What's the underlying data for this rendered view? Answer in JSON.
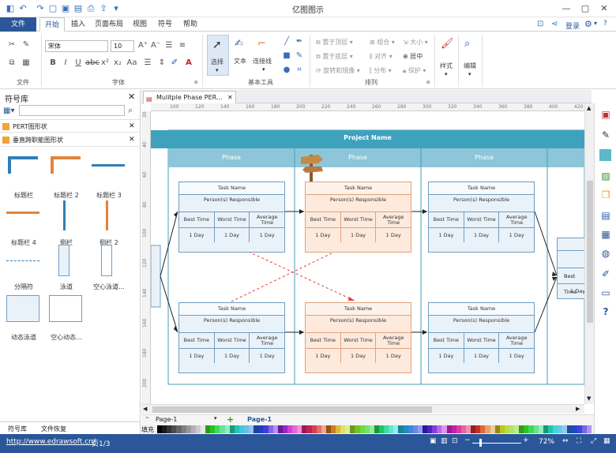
{
  "app_title": "亿图图示",
  "quick_access": [
    "logo-icon",
    "undo-icon",
    "redo-icon",
    "new-icon",
    "open-icon",
    "save-icon",
    "print-icon",
    "export-icon",
    "more-icon"
  ],
  "menu": {
    "file": "文件",
    "tabs": [
      "开始",
      "插入",
      "页面布局",
      "视图",
      "符号",
      "帮助"
    ],
    "login": "登录"
  },
  "ribbon": {
    "group_file": "文件",
    "group_font": "字体",
    "group_basic": "基本工具",
    "group_arrange": "排列",
    "font_name": "宋体",
    "font_size": "10",
    "select": "选择",
    "text": "文本",
    "connector": "连接线",
    "bring_front": "置于顶层",
    "send_back": "置于底层",
    "rotate": "旋转和镜像",
    "group": "组合",
    "align": "对齐",
    "distribute": "分布",
    "size": "大小",
    "center": "居中",
    "protect": "保护",
    "style": "样式",
    "edit": "编辑"
  },
  "library": {
    "title": "符号库",
    "search_placeholder": "",
    "sections": [
      "PERT图形状",
      "垂直跨职能图形状"
    ],
    "shapes": [
      "标题栏",
      "标题栏 2",
      "标题栏 3",
      "标题栏 4",
      "侧栏",
      "侧栏 2",
      "分隔符",
      "泳道",
      "空心泳道...",
      "动态泳道",
      "空心动态..."
    ],
    "bottom_tabs": [
      "符号库",
      "文件恢复"
    ]
  },
  "document": {
    "tab_title": "Mulitple Phase PER...",
    "ruler_h": [
      "100",
      "120",
      "140",
      "160",
      "180",
      "200",
      "220",
      "240",
      "260",
      "280",
      "300",
      "320",
      "340",
      "360",
      "380",
      "400",
      "420"
    ],
    "ruler_v": [
      "20",
      "40",
      "60",
      "80",
      "100",
      "120",
      "140",
      "160",
      "180",
      "200"
    ]
  },
  "diagram": {
    "project_name": "Project Name",
    "phases": [
      "Phase",
      "Phase",
      "Phase"
    ],
    "task": {
      "name": "Task Name",
      "responsible": "Person(s) Responsible",
      "best": "Best Time",
      "worst": "Worst Time",
      "avg": "Average Time",
      "value": "1 Day"
    }
  },
  "pages": {
    "current": "Page-1",
    "tab": "Page-1",
    "fill_label": "填充"
  },
  "status": {
    "url": "http://www.edrawsoft.cn/",
    "page": "页1/3",
    "zoom": "72%"
  },
  "colors": {
    "accent": "#2b579a",
    "header_teal": "#3fa2bd",
    "task_blue": "#eaf2f9",
    "task_orange": "#fdeadd",
    "arrow_red": "#e03c3c"
  }
}
